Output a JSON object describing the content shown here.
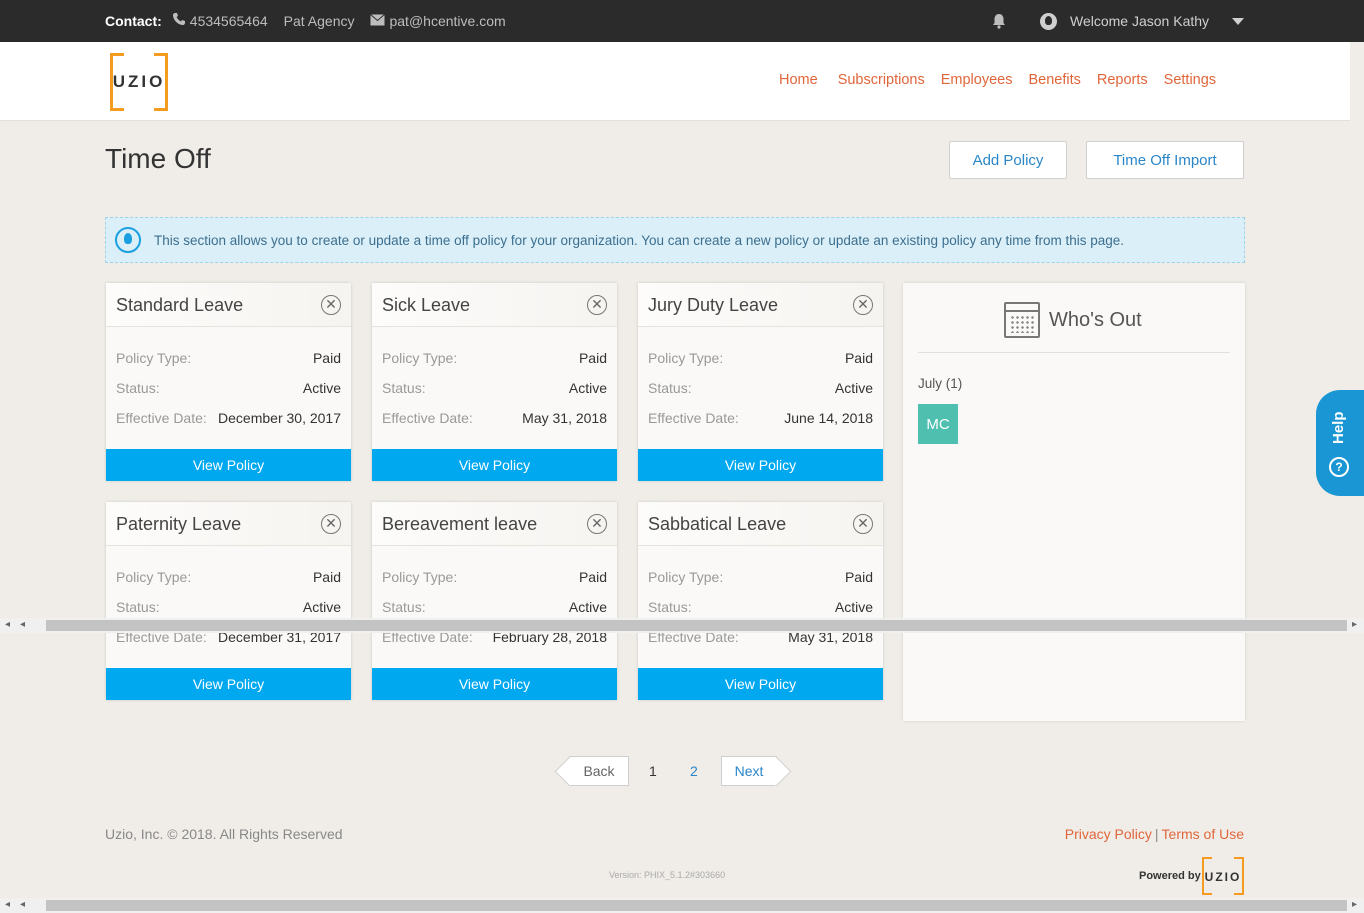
{
  "topbar": {
    "contact_label": "Contact:",
    "phone": "4534565464",
    "agency": "Pat Agency",
    "email": "pat@hcentive.com",
    "welcome": "Welcome Jason Kathy",
    "icons": [
      "phone-icon",
      "mail-icon",
      "bell-icon",
      "user-icon",
      "chevron-down-icon"
    ]
  },
  "header": {
    "logo": "UZIO",
    "nav": [
      "Home",
      "Subscriptions",
      "Employees",
      "Benefits",
      "Reports",
      "Settings"
    ]
  },
  "page": {
    "title": "Time Off",
    "add_policy": "Add Policy",
    "import": "Time Off Import",
    "info": "This section allows you to create or update a time off policy for your organization. You can create a new policy or update an existing policy any time from this page."
  },
  "labels": {
    "policy_type": "Policy Type:",
    "status": "Status:",
    "effective_date": "Effective Date:",
    "view_policy": "View Policy"
  },
  "policies": [
    {
      "name": "Standard Leave",
      "type": "Paid",
      "status": "Active",
      "date": "December 30, 2017"
    },
    {
      "name": "Sick Leave",
      "type": "Paid",
      "status": "Active",
      "date": "May 31, 2018"
    },
    {
      "name": "Jury Duty Leave",
      "type": "Paid",
      "status": "Active",
      "date": "June 14, 2018"
    },
    {
      "name": "Paternity Leave",
      "type": "Paid",
      "status": "Active",
      "date": "December 31, 2017"
    },
    {
      "name": "Bereavement leave",
      "type": "Paid",
      "status": "Active",
      "date": "February 28, 2018"
    },
    {
      "name": "Sabbatical Leave",
      "type": "Paid",
      "status": "Active",
      "date": "May 31, 2018"
    }
  ],
  "whos_out": {
    "title": "Who's Out",
    "month": "July (1)",
    "avatar": "MC"
  },
  "help": {
    "label": "Help",
    "q": "?"
  },
  "pager": {
    "back": "Back",
    "pages": [
      "1",
      "2"
    ],
    "next": "Next"
  },
  "footer": {
    "copyright": "Uzio, Inc. © 2018. All Rights Reserved",
    "privacy": "Privacy Policy",
    "separator": "|",
    "terms": "Terms of Use",
    "version": "Version: PHIX_5.1.2#303660",
    "powered_by": "Powered by",
    "logo": "UZIO"
  },
  "colors": {
    "accent": "#00a8f0",
    "nav": "#e0663a",
    "logo": "#f39c1f",
    "avatar": "#4fbfb0",
    "help": "#1a96d4"
  }
}
